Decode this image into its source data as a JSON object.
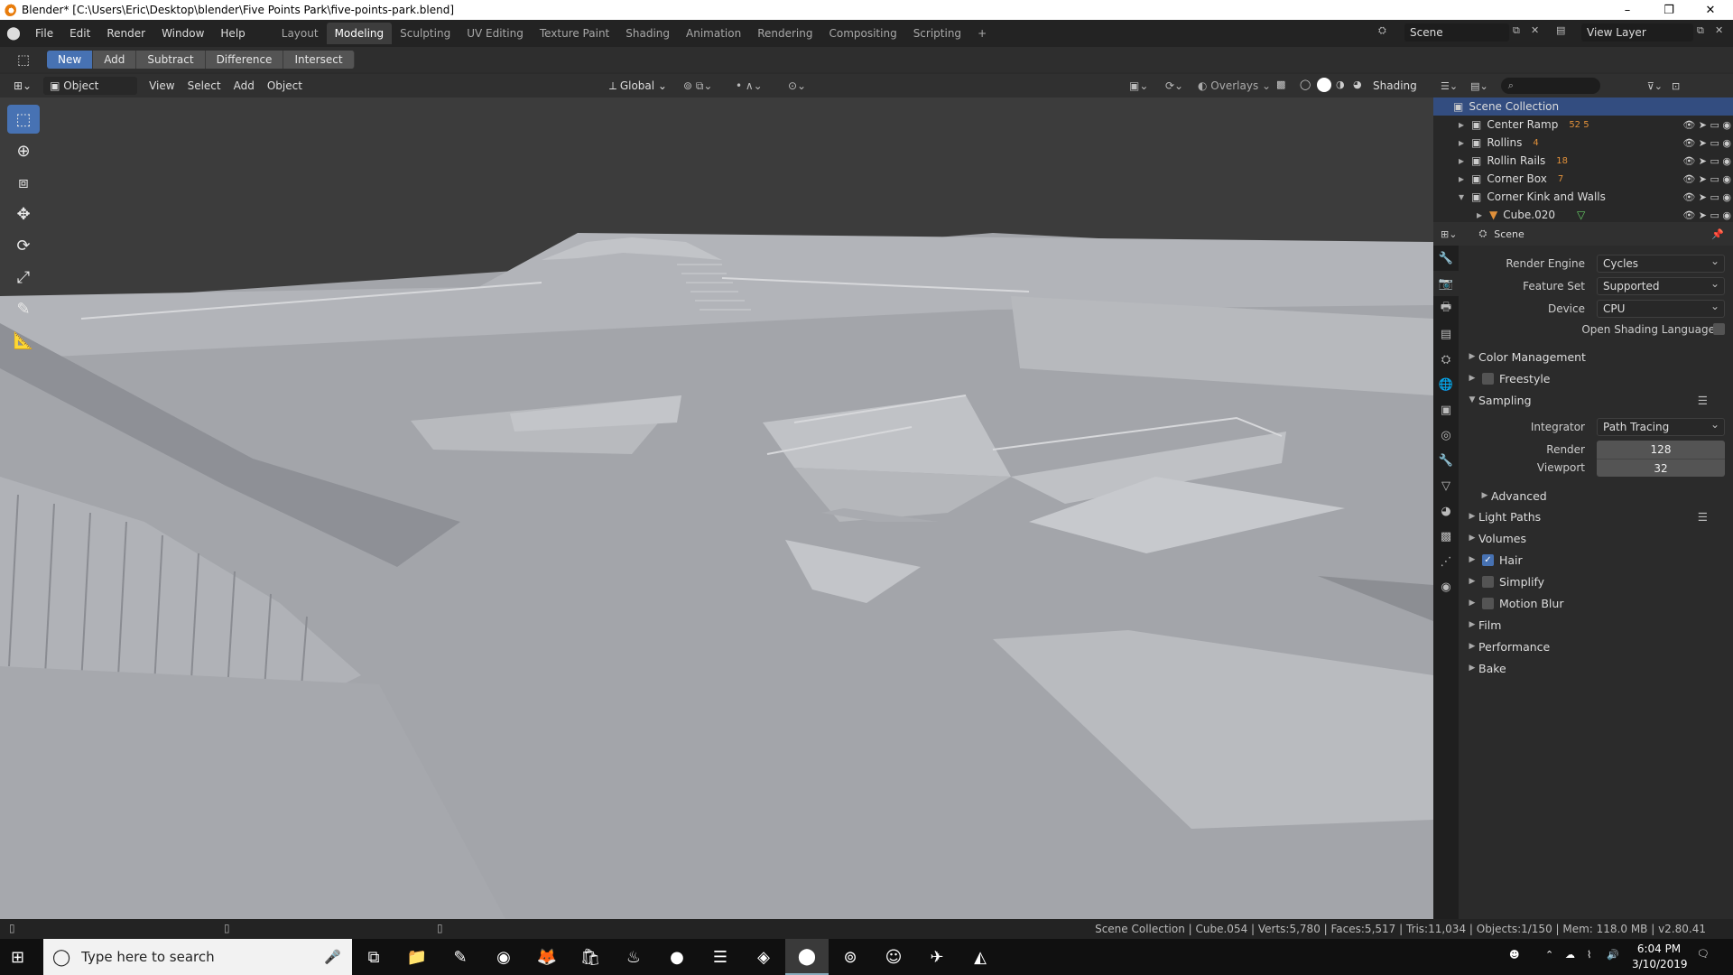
{
  "window": {
    "title": "Blender* [C:\\Users\\Eric\\Desktop\\blender\\Five Points Park\\five-points-park.blend]",
    "minimize": "–",
    "maximize": "❐",
    "close": "✕"
  },
  "menu": [
    "File",
    "Edit",
    "Render",
    "Window",
    "Help"
  ],
  "workspaces": [
    "Layout",
    "Modeling",
    "Sculpting",
    "UV Editing",
    "Texture Paint",
    "Shading",
    "Animation",
    "Rendering",
    "Compositing",
    "Scripting"
  ],
  "workspace_active": "Modeling",
  "scene_field": "Scene",
  "view_layer_field": "View Layer",
  "bool_buttons": [
    "New",
    "Add",
    "Subtract",
    "Difference",
    "Intersect"
  ],
  "viewport_header": {
    "mode": "Object Mode",
    "menus": [
      "View",
      "Select",
      "Add",
      "Object"
    ],
    "orientation": "Global",
    "overlays": "Overlays",
    "shading": "Shading"
  },
  "tools": [
    "select-box",
    "cursor",
    "move-all",
    "move",
    "rotate",
    "scale",
    "annotate",
    "measure"
  ],
  "outliner": {
    "search_placeholder": "",
    "root": "Scene Collection",
    "rows": [
      {
        "label": "Center Ramp",
        "badge": "52 5"
      },
      {
        "label": "Rollins",
        "badge": "4"
      },
      {
        "label": "Rollin Rails",
        "badge": "18"
      },
      {
        "label": "Corner Box",
        "badge": "7"
      },
      {
        "label": "Corner Kink and Walls",
        "badge": ""
      },
      {
        "label": "Cube.020",
        "badge": ""
      }
    ]
  },
  "properties": {
    "context": "Scene",
    "render_engine_label": "Render Engine",
    "render_engine": "Cycles",
    "feature_set_label": "Feature Set",
    "feature_set": "Supported",
    "device_label": "Device",
    "device": "CPU",
    "osl_label": "Open Shading Language",
    "integrator_label": "Integrator",
    "integrator": "Path Tracing",
    "render_label": "Render",
    "render_samples": "128",
    "viewport_label": "Viewport",
    "viewport_samples": "32",
    "panels": {
      "color_management": "Color Management",
      "freestyle": "Freestyle",
      "sampling": "Sampling",
      "advanced": "Advanced",
      "light_paths": "Light Paths",
      "volumes": "Volumes",
      "hair": "Hair",
      "simplify": "Simplify",
      "motion_blur": "Motion Blur",
      "film": "Film",
      "performance": "Performance",
      "bake": "Bake"
    }
  },
  "status": "Scene Collection | Cube.054 | Verts:5,780 | Faces:5,517 | Tris:11,034 | Objects:1/150 | Mem: 118.0 MB | v2.80.41",
  "taskbar": {
    "search_placeholder": "Type here to search",
    "time": "6:04 PM",
    "date": "3/10/2019"
  },
  "colors": {
    "accent": "#4772b3",
    "selected_row": "#334d80",
    "viewport": "#9b9da2"
  }
}
